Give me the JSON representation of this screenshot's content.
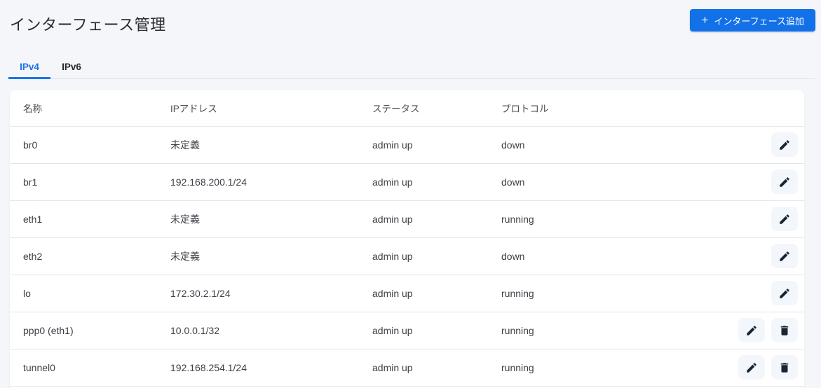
{
  "page": {
    "title": "インターフェース管理"
  },
  "toolbar": {
    "add_button_label": "インターフェース追加",
    "add_button_icon": "plus-icon"
  },
  "tabs": [
    {
      "label": "IPv4",
      "active": true
    },
    {
      "label": "IPv6",
      "active": false
    }
  ],
  "table": {
    "columns": [
      "名称",
      "IPアドレス",
      "ステータス",
      "プロトコル"
    ],
    "rows": [
      {
        "name": "br0",
        "ip": "未定義",
        "status": "admin up",
        "protocol": "down",
        "actions": [
          "edit"
        ]
      },
      {
        "name": "br1",
        "ip": "192.168.200.1/24",
        "status": "admin up",
        "protocol": "down",
        "actions": [
          "edit"
        ]
      },
      {
        "name": "eth1",
        "ip": "未定義",
        "status": "admin up",
        "protocol": "running",
        "actions": [
          "edit"
        ]
      },
      {
        "name": "eth2",
        "ip": "未定義",
        "status": "admin up",
        "protocol": "down",
        "actions": [
          "edit"
        ]
      },
      {
        "name": "lo",
        "ip": "172.30.2.1/24",
        "status": "admin up",
        "protocol": "running",
        "actions": [
          "edit"
        ]
      },
      {
        "name": "ppp0 (eth1)",
        "ip": "10.0.0.1/32",
        "status": "admin up",
        "protocol": "running",
        "actions": [
          "edit",
          "delete"
        ]
      },
      {
        "name": "tunnel0",
        "ip": "192.168.254.1/24",
        "status": "admin up",
        "protocol": "running",
        "actions": [
          "edit",
          "delete"
        ]
      }
    ],
    "action_icons": {
      "edit": "edit-pencil-icon",
      "delete": "trash-icon"
    }
  },
  "colors": {
    "accent_blue": "#1a73e8",
    "button_blue": "#1271e8",
    "page_background": "#f5f6fa",
    "card_background": "#ffffff",
    "row_border": "#e3e5ed",
    "icon_dark": "#1b2434",
    "action_button_background": "#f3f6fa"
  }
}
